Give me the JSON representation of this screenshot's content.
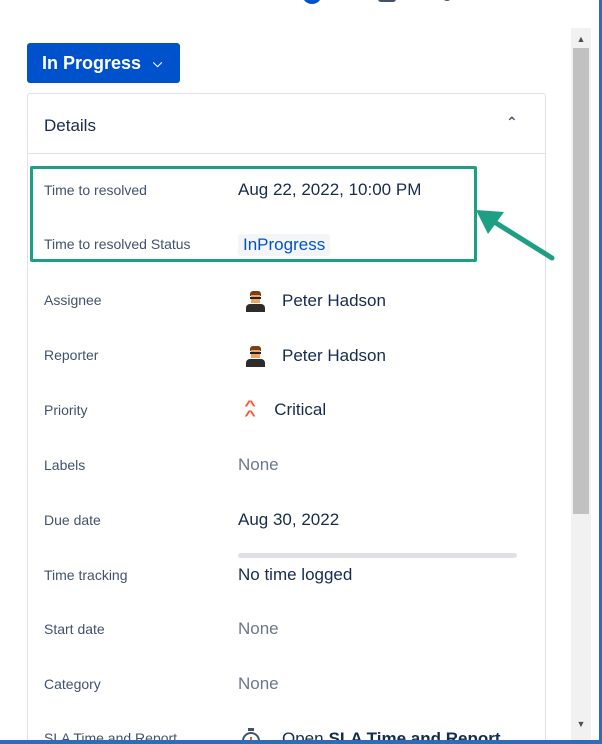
{
  "header": {
    "status_button": {
      "label": "In Progress",
      "chevron": "chevron-down-icon"
    }
  },
  "details": {
    "title": "Details",
    "toggle_icon": "chevron-up-icon",
    "fields": {
      "time_to_resolved": {
        "label": "Time to resolved",
        "value": "Aug 22, 2022, 10:00 PM"
      },
      "time_to_resolved_status": {
        "label": "Time to resolved Status",
        "value": "InProgress"
      },
      "assignee": {
        "label": "Assignee",
        "value": "Peter Hadson"
      },
      "reporter": {
        "label": "Reporter",
        "value": "Peter Hadson"
      },
      "priority": {
        "label": "Priority",
        "value": "Critical",
        "icon": "priority-critical-icon",
        "color": "#ff5630"
      },
      "labels": {
        "label": "Labels",
        "value": "None"
      },
      "due_date": {
        "label": "Due date",
        "value": "Aug 30, 2022"
      },
      "time_tracking": {
        "label": "Time tracking",
        "value": "No time logged"
      },
      "start_date": {
        "label": "Start date",
        "value": "None"
      },
      "category": {
        "label": "Category",
        "value": "None"
      },
      "sla": {
        "label": "SLA Time and Report",
        "value_prefix": "Open",
        "value_link": "SLA Time and Report"
      }
    }
  },
  "colors": {
    "primary": "#0052cc",
    "highlight": "#1d9f84",
    "text": "#172b4d",
    "muted": "#6b778c"
  }
}
